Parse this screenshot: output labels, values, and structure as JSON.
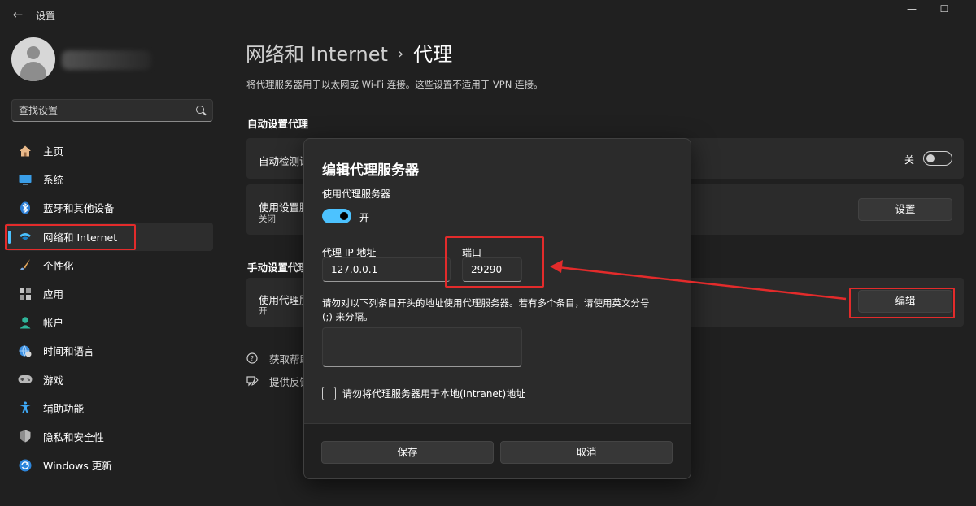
{
  "window": {
    "back_icon": "back-arrow-icon",
    "title": "设置",
    "controls": [
      "minimize-icon",
      "maximize-icon"
    ]
  },
  "sidebar": {
    "search_placeholder": "查找设置",
    "items": [
      {
        "label": "主页",
        "icon": "home-icon"
      },
      {
        "label": "系统",
        "icon": "monitor-icon"
      },
      {
        "label": "蓝牙和其他设备",
        "icon": "bluetooth-icon"
      },
      {
        "label": "网络和 Internet",
        "icon": "network-icon",
        "active": true
      },
      {
        "label": "个性化",
        "icon": "brush-icon"
      },
      {
        "label": "应用",
        "icon": "apps-icon"
      },
      {
        "label": "帐户",
        "icon": "account-icon"
      },
      {
        "label": "时间和语言",
        "icon": "globe-clock-icon"
      },
      {
        "label": "游戏",
        "icon": "gamepad-icon"
      },
      {
        "label": "辅助功能",
        "icon": "accessibility-icon"
      },
      {
        "label": "隐私和安全性",
        "icon": "shield-icon"
      },
      {
        "label": "Windows 更新",
        "icon": "update-icon"
      }
    ]
  },
  "main": {
    "breadcrumb_parent": "网络和 Internet",
    "breadcrumb_current": "代理",
    "description": "将代理服务器用于以太网或 Wi-Fi 连接。这些设置不适用于 VPN 连接。",
    "auto_section": {
      "title": "自动设置代理",
      "detect_label": "自动检测设",
      "detect_state": "关",
      "script_label": "使用设置脚",
      "script_sub": "关闭",
      "script_button": "设置"
    },
    "manual_section": {
      "title": "手动设置代理",
      "proxy_label": "使用代理服",
      "proxy_sub": "开",
      "edit_button": "编辑"
    },
    "links": [
      {
        "label": "获取帮助",
        "icon": "help-icon"
      },
      {
        "label": "提供反馈",
        "icon": "feedback-icon"
      }
    ]
  },
  "dialog": {
    "title": "编辑代理服务器",
    "use_proxy_label": "使用代理服务器",
    "toggle_state": "开",
    "ip_label": "代理 IP 地址",
    "ip_value": "127.0.0.1",
    "port_label": "端口",
    "port_value": "29290",
    "exceptions_label_line1": "请勿对以下列条目开头的地址使用代理服务器。若有多个条目，请使用英文分号",
    "exceptions_label_line2": "(;) 来分隔。",
    "exceptions_value": "",
    "local_checkbox_label": "请勿将代理服务器用于本地(Intranet)地址",
    "save_button": "保存",
    "cancel_button": "取消"
  },
  "colors": {
    "accent": "#4cc2ff",
    "annotation": "#e32b2b",
    "background": "#202020",
    "card": "#2b2b2b"
  }
}
